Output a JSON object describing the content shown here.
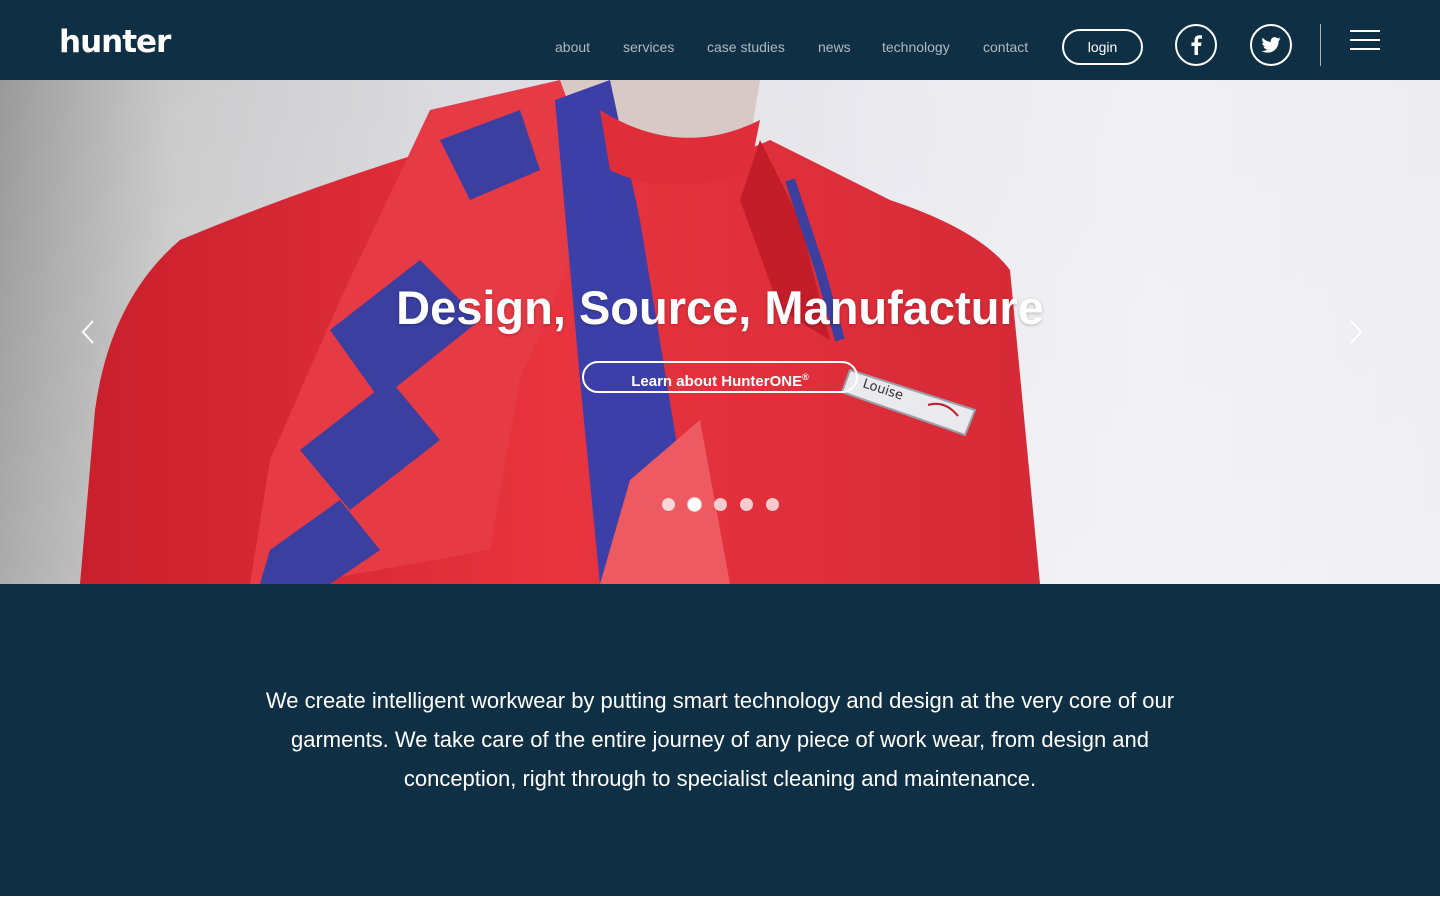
{
  "brand": {
    "logo_text": "hunter"
  },
  "nav": {
    "links": [
      "about",
      "services",
      "case studies",
      "news",
      "technology",
      "contact"
    ],
    "login_label": "login"
  },
  "social": {
    "icons": [
      "facebook-icon",
      "twitter-icon"
    ]
  },
  "hero": {
    "title": "Design, Source, Manufacture",
    "cta_label": "Learn about HunterONE",
    "cta_mark": "®",
    "badge_name": "Louise",
    "slides_count": 5,
    "active_slide": 2
  },
  "intro": {
    "text": "We create intelligent workwear by putting smart technology and design at the very core of our garments. We take care of the entire journey of any piece of work wear, from design and conception, right through to specialist cleaning and maintenance."
  },
  "colors": {
    "navy": "#0f3044",
    "nav_text": "#aeb9c1",
    "uniform_red": "#e5343f",
    "scarf_blue": "#3a3fa0"
  }
}
